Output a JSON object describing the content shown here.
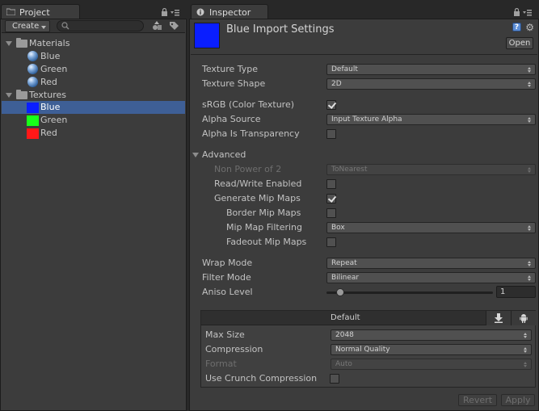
{
  "project": {
    "tab_label": "Project",
    "create_label": "Create",
    "search_placeholder": "",
    "tree": [
      {
        "label": "Materials",
        "type": "folder"
      },
      {
        "label": "Blue",
        "type": "material"
      },
      {
        "label": "Green",
        "type": "material"
      },
      {
        "label": "Red",
        "type": "material"
      },
      {
        "label": "Textures",
        "type": "folder"
      },
      {
        "label": "Blue",
        "type": "texture",
        "color": "#0a1eff",
        "selected": true
      },
      {
        "label": "Green",
        "type": "texture",
        "color": "#18ff18"
      },
      {
        "label": "Red",
        "type": "texture",
        "color": "#ff1818"
      }
    ]
  },
  "inspector": {
    "tab_label": "Inspector",
    "title": "Blue Import Settings",
    "preview_color": "#0a1eff",
    "open_label": "Open",
    "help_label": "?",
    "fields": {
      "texture_type": {
        "label": "Texture Type",
        "value": "Default"
      },
      "texture_shape": {
        "label": "Texture Shape",
        "value": "2D"
      },
      "srgb": {
        "label": "sRGB (Color Texture)",
        "checked": true
      },
      "alpha_source": {
        "label": "Alpha Source",
        "value": "Input Texture Alpha"
      },
      "alpha_transparency": {
        "label": "Alpha Is Transparency",
        "checked": false
      },
      "advanced": {
        "label": "Advanced"
      },
      "non_power_of_2": {
        "label": "Non Power of 2",
        "value": "ToNearest"
      },
      "read_write": {
        "label": "Read/Write Enabled",
        "checked": false
      },
      "generate_mip": {
        "label": "Generate Mip Maps",
        "checked": true
      },
      "border_mip": {
        "label": "Border Mip Maps",
        "checked": false
      },
      "mip_filtering": {
        "label": "Mip Map Filtering",
        "value": "Box"
      },
      "fadeout_mip": {
        "label": "Fadeout Mip Maps",
        "checked": false
      },
      "wrap_mode": {
        "label": "Wrap Mode",
        "value": "Repeat"
      },
      "filter_mode": {
        "label": "Filter Mode",
        "value": "Bilinear"
      },
      "aniso_level": {
        "label": "Aniso Level",
        "value": "1",
        "slider_fraction": 0.0625
      }
    },
    "platform": {
      "tab_label": "Default",
      "max_size": {
        "label": "Max Size",
        "value": "2048"
      },
      "compression": {
        "label": "Compression",
        "value": "Normal Quality"
      },
      "format": {
        "label": "Format",
        "value": "Auto"
      },
      "crunch": {
        "label": "Use Crunch Compression",
        "checked": false
      }
    },
    "revert_label": "Revert",
    "apply_label": "Apply"
  },
  "colors": {
    "selection": "#3e5f96",
    "panel": "#3c3c3c",
    "background": "#282828"
  }
}
